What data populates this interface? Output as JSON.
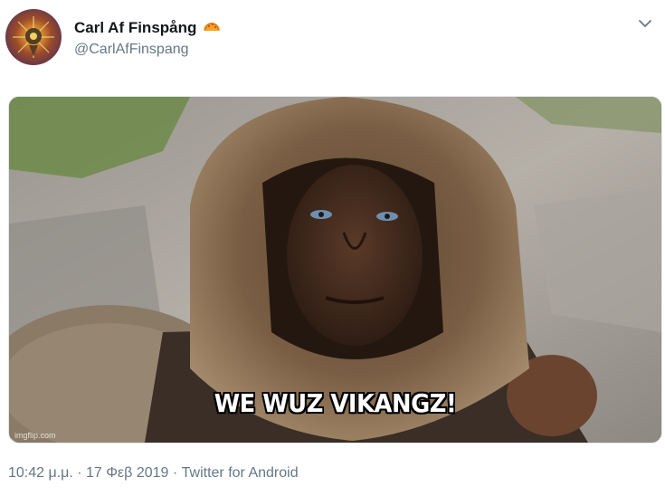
{
  "tweet": {
    "author": {
      "display_name": "Carl Af Finspång",
      "handle": "@CarlAfFinspang",
      "badge_icon": "taco-icon"
    },
    "menu_icon": "chevron-down-icon",
    "media": {
      "caption": "WE WUZ VIKANGZ!",
      "watermark": "imgflip.com"
    },
    "meta": {
      "time": "10:42 μ.μ.",
      "separator": " · ",
      "date": "17 Φεβ 2019",
      "source": "Twitter for Android"
    },
    "colors": {
      "text_primary": "#14171a",
      "text_secondary": "#657786",
      "border": "#e1e8ed"
    }
  }
}
